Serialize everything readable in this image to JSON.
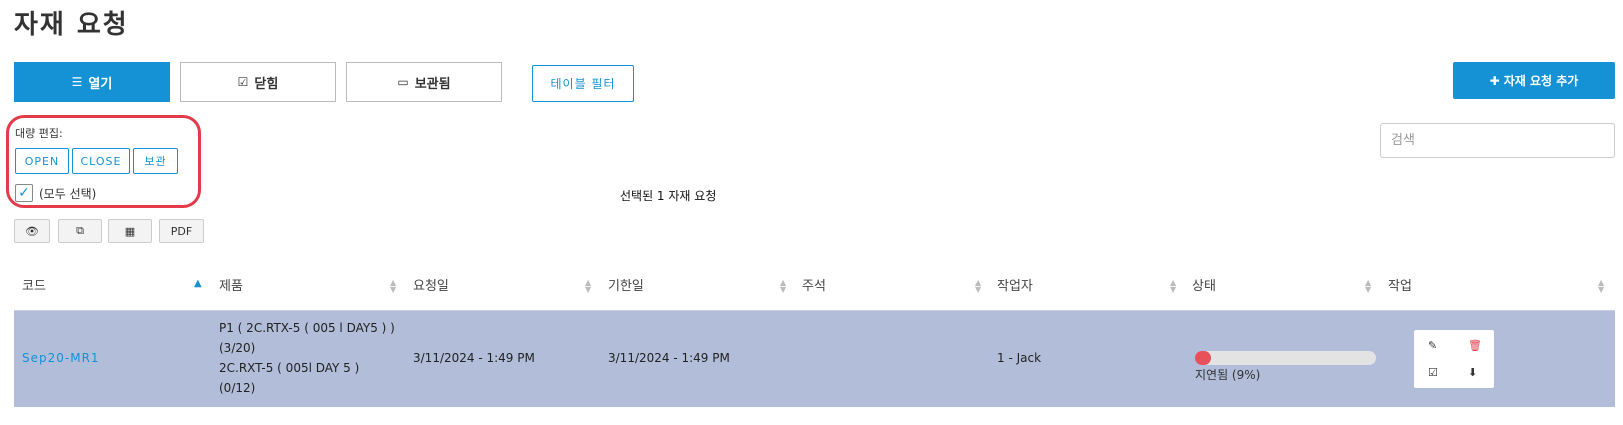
{
  "page": {
    "title": "자재 요청"
  },
  "tabs": [
    {
      "label": "열기",
      "icon": "list-icon",
      "active": true
    },
    {
      "label": "닫힘",
      "icon": "checkbox-icon",
      "active": false
    },
    {
      "label": "보관됨",
      "icon": "archive-icon",
      "active": false
    }
  ],
  "toolbar": {
    "filter_label": "테이블 필터",
    "add_label": "자재 요청 추가"
  },
  "bulk_edit": {
    "label": "대량 편집:",
    "buttons": [
      "OPEN",
      "CLOSE",
      "보관"
    ],
    "select_all_label": "(모두 선택)",
    "select_all_checked": true
  },
  "selection": {
    "text": "선택된 1 자재 요청"
  },
  "search": {
    "placeholder": "검색"
  },
  "export_buttons": [
    {
      "icon": "eye-icon"
    },
    {
      "icon": "copy-icon"
    },
    {
      "icon": "spreadsheet-icon"
    },
    {
      "label": "PDF"
    }
  ],
  "table": {
    "headers": [
      "코드",
      "제품",
      "요청일",
      "기한일",
      "주석",
      "작업자",
      "상태",
      "작업"
    ],
    "sorted_column": "코드",
    "rows": [
      {
        "code": "Sep20-MR1",
        "products": [
          "P1 ( 2C.RTX-5 ( 005 l DAY5 ) )",
          "(3/20)",
          "2C.RXT-5 ( 005l DAY 5 )",
          "(0/12)"
        ],
        "request_date": "3/11/2024 - 1:49 PM",
        "due_date": "3/11/2024 - 1:49 PM",
        "note": "",
        "worker": "1 - Jack",
        "status_text": "지연됨 (9%)",
        "progress_percent": 9,
        "selected": true
      }
    ]
  },
  "colors": {
    "accent": "#1592d5",
    "highlight_row": "#b1bdd9",
    "bulk_outline": "#e33b4a",
    "progress_fill": "#e8505b"
  }
}
